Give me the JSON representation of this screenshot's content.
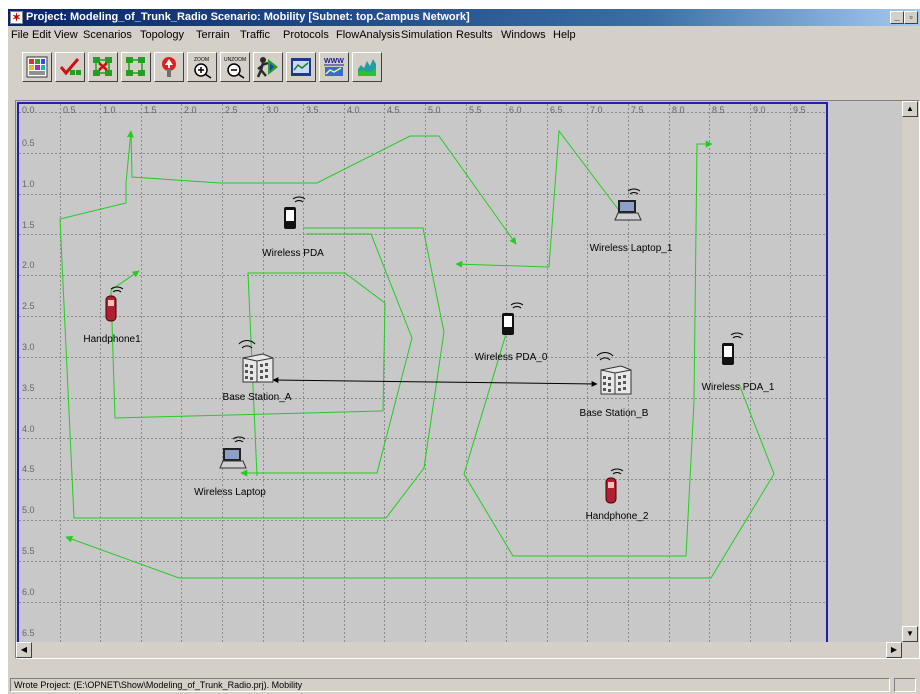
{
  "window": {
    "title": "Project: Modeling_of_Trunk_Radio Scenario: Mobility  [Subnet: top.Campus Network]"
  },
  "menu": [
    "File",
    "Edit",
    "View",
    "Scenarios",
    "Topology",
    "Terrain",
    "Traffic",
    "Protocols",
    "FlowAnalysis",
    "Simulation",
    "Results",
    "Windows",
    "Help"
  ],
  "toolbar": {
    "buttons": [
      {
        "name": "open-object-palette",
        "icon": "palette-icon"
      },
      {
        "name": "check-link-consistency",
        "icon": "check-link-icon"
      },
      {
        "name": "fail-selected-objects",
        "icon": "fail-node-icon"
      },
      {
        "name": "recover-selected-objects",
        "icon": "recover-node-icon"
      },
      {
        "name": "return-to-parent-subnet",
        "icon": "parent-subnet-icon"
      },
      {
        "name": "zoom",
        "icon": "zoom-in-icon",
        "label": "ZOOM"
      },
      {
        "name": "unzoom",
        "icon": "zoom-out-icon",
        "label": "UNZOOM"
      },
      {
        "name": "configure-discrete-event-simulation",
        "icon": "run-simulation-icon"
      },
      {
        "name": "view-results",
        "icon": "view-results-icon"
      },
      {
        "name": "web-report",
        "icon": "web-report-icon",
        "label": "WWW"
      },
      {
        "name": "hide-show-graphs",
        "icon": "graphs-icon"
      }
    ]
  },
  "grid": {
    "x_ticks": [
      "0.0",
      "0.5",
      "1.0",
      "1.5",
      "2.0",
      "2.5",
      "3.0",
      "3.5",
      "4.0",
      "4.5",
      "5.0",
      "5.5",
      "6.0",
      "6.5",
      "7.0",
      "7.5",
      "8.0",
      "8.5",
      "9.0",
      "9.5"
    ],
    "y_ticks": [
      "0.5",
      "1.0",
      "1.5",
      "2.0",
      "2.5",
      "3.0",
      "3.5",
      "4.0",
      "4.5",
      "5.0",
      "5.5",
      "6.0",
      "6.5"
    ],
    "colors": {
      "background": "#c8c8c8",
      "gridline": "#8c8c8c",
      "trajectory": "#22cc22",
      "link": "#000000",
      "border": "#2020b0"
    }
  },
  "nodes": [
    {
      "name": "wireless-pda",
      "label": "Wireless PDA",
      "type": "pda"
    },
    {
      "name": "wireless-laptop-1",
      "label": "Wireless Laptop_1",
      "type": "laptop"
    },
    {
      "name": "handphone1",
      "label": "Handphone1",
      "type": "phone"
    },
    {
      "name": "wireless-pda-0",
      "label": "Wireless PDA_0",
      "type": "pda"
    },
    {
      "name": "wireless-pda-1",
      "label": "Wireless PDA_1",
      "type": "pda"
    },
    {
      "name": "base-station-a",
      "label": "Base Station_A",
      "type": "base"
    },
    {
      "name": "base-station-b",
      "label": "Base Station_B",
      "type": "base"
    },
    {
      "name": "wireless-laptop",
      "label": "Wireless Laptop",
      "type": "laptop"
    },
    {
      "name": "handphone-2",
      "label": "Handphone_2",
      "type": "phone"
    }
  ],
  "status": {
    "message": "Wrote Project: (E:\\OPNET\\Show\\Modeling_of_Trunk_Radio.prj).  Mobility"
  }
}
